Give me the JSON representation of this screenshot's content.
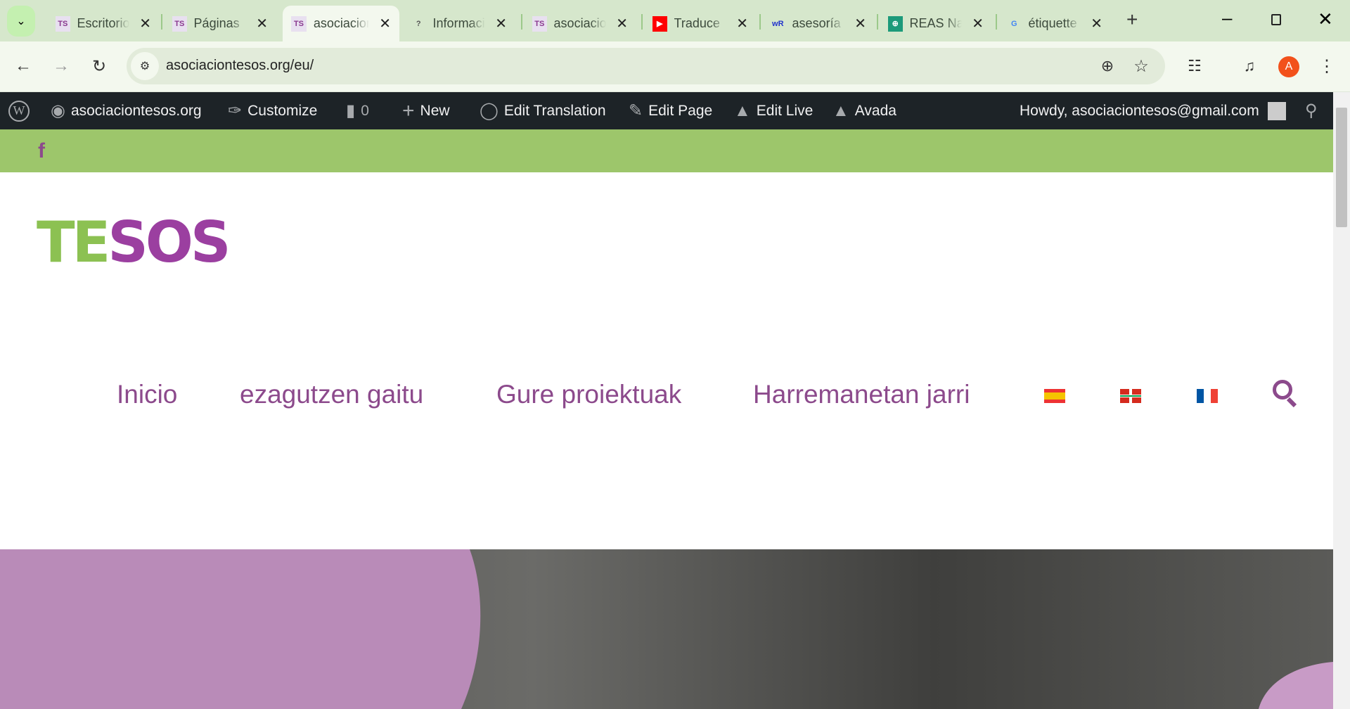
{
  "browser": {
    "tabs": [
      {
        "title": "Escritorio",
        "favicon": "tesos-icon",
        "active": false
      },
      {
        "title": "Páginas",
        "favicon": "tesos-icon",
        "active": false
      },
      {
        "title": "asociaciontesos",
        "favicon": "tesos-icon",
        "active": true
      },
      {
        "title": "Informacion",
        "favicon": "translate-icon",
        "active": false
      },
      {
        "title": "asociaciontesos",
        "favicon": "tesos-icon",
        "active": false
      },
      {
        "title": "Traduce",
        "favicon": "youtube-icon",
        "active": false
      },
      {
        "title": "asesoría",
        "favicon": "wordreference-icon",
        "active": false
      },
      {
        "title": "REAS Navarra",
        "favicon": "globe-icon",
        "active": false
      },
      {
        "title": "étiquette",
        "favicon": "google-icon",
        "active": false
      }
    ],
    "url": "asociaciontesos.org/eu/",
    "profile_initial": "A"
  },
  "admin_bar": {
    "site": "asociaciontesos.org",
    "customize": "Customize",
    "comments": "0",
    "new": "New",
    "edit_translation": "Edit Translation",
    "edit_page": "Edit Page",
    "edit_live": "Edit Live",
    "avada": "Avada",
    "howdy": "Howdy, asociaciontesos@gmail.com"
  },
  "social": {
    "facebook": "f"
  },
  "logo": "TESOS",
  "nav": [
    "Inicio",
    "ezagutzen gaitu",
    "Gure proiektuak",
    "Harremanetan jarri"
  ],
  "languages": [
    "es",
    "eu",
    "fr"
  ],
  "colors": {
    "accent": "#8c4a8c",
    "green": "#9dc66b",
    "admin": "#1d2327"
  }
}
